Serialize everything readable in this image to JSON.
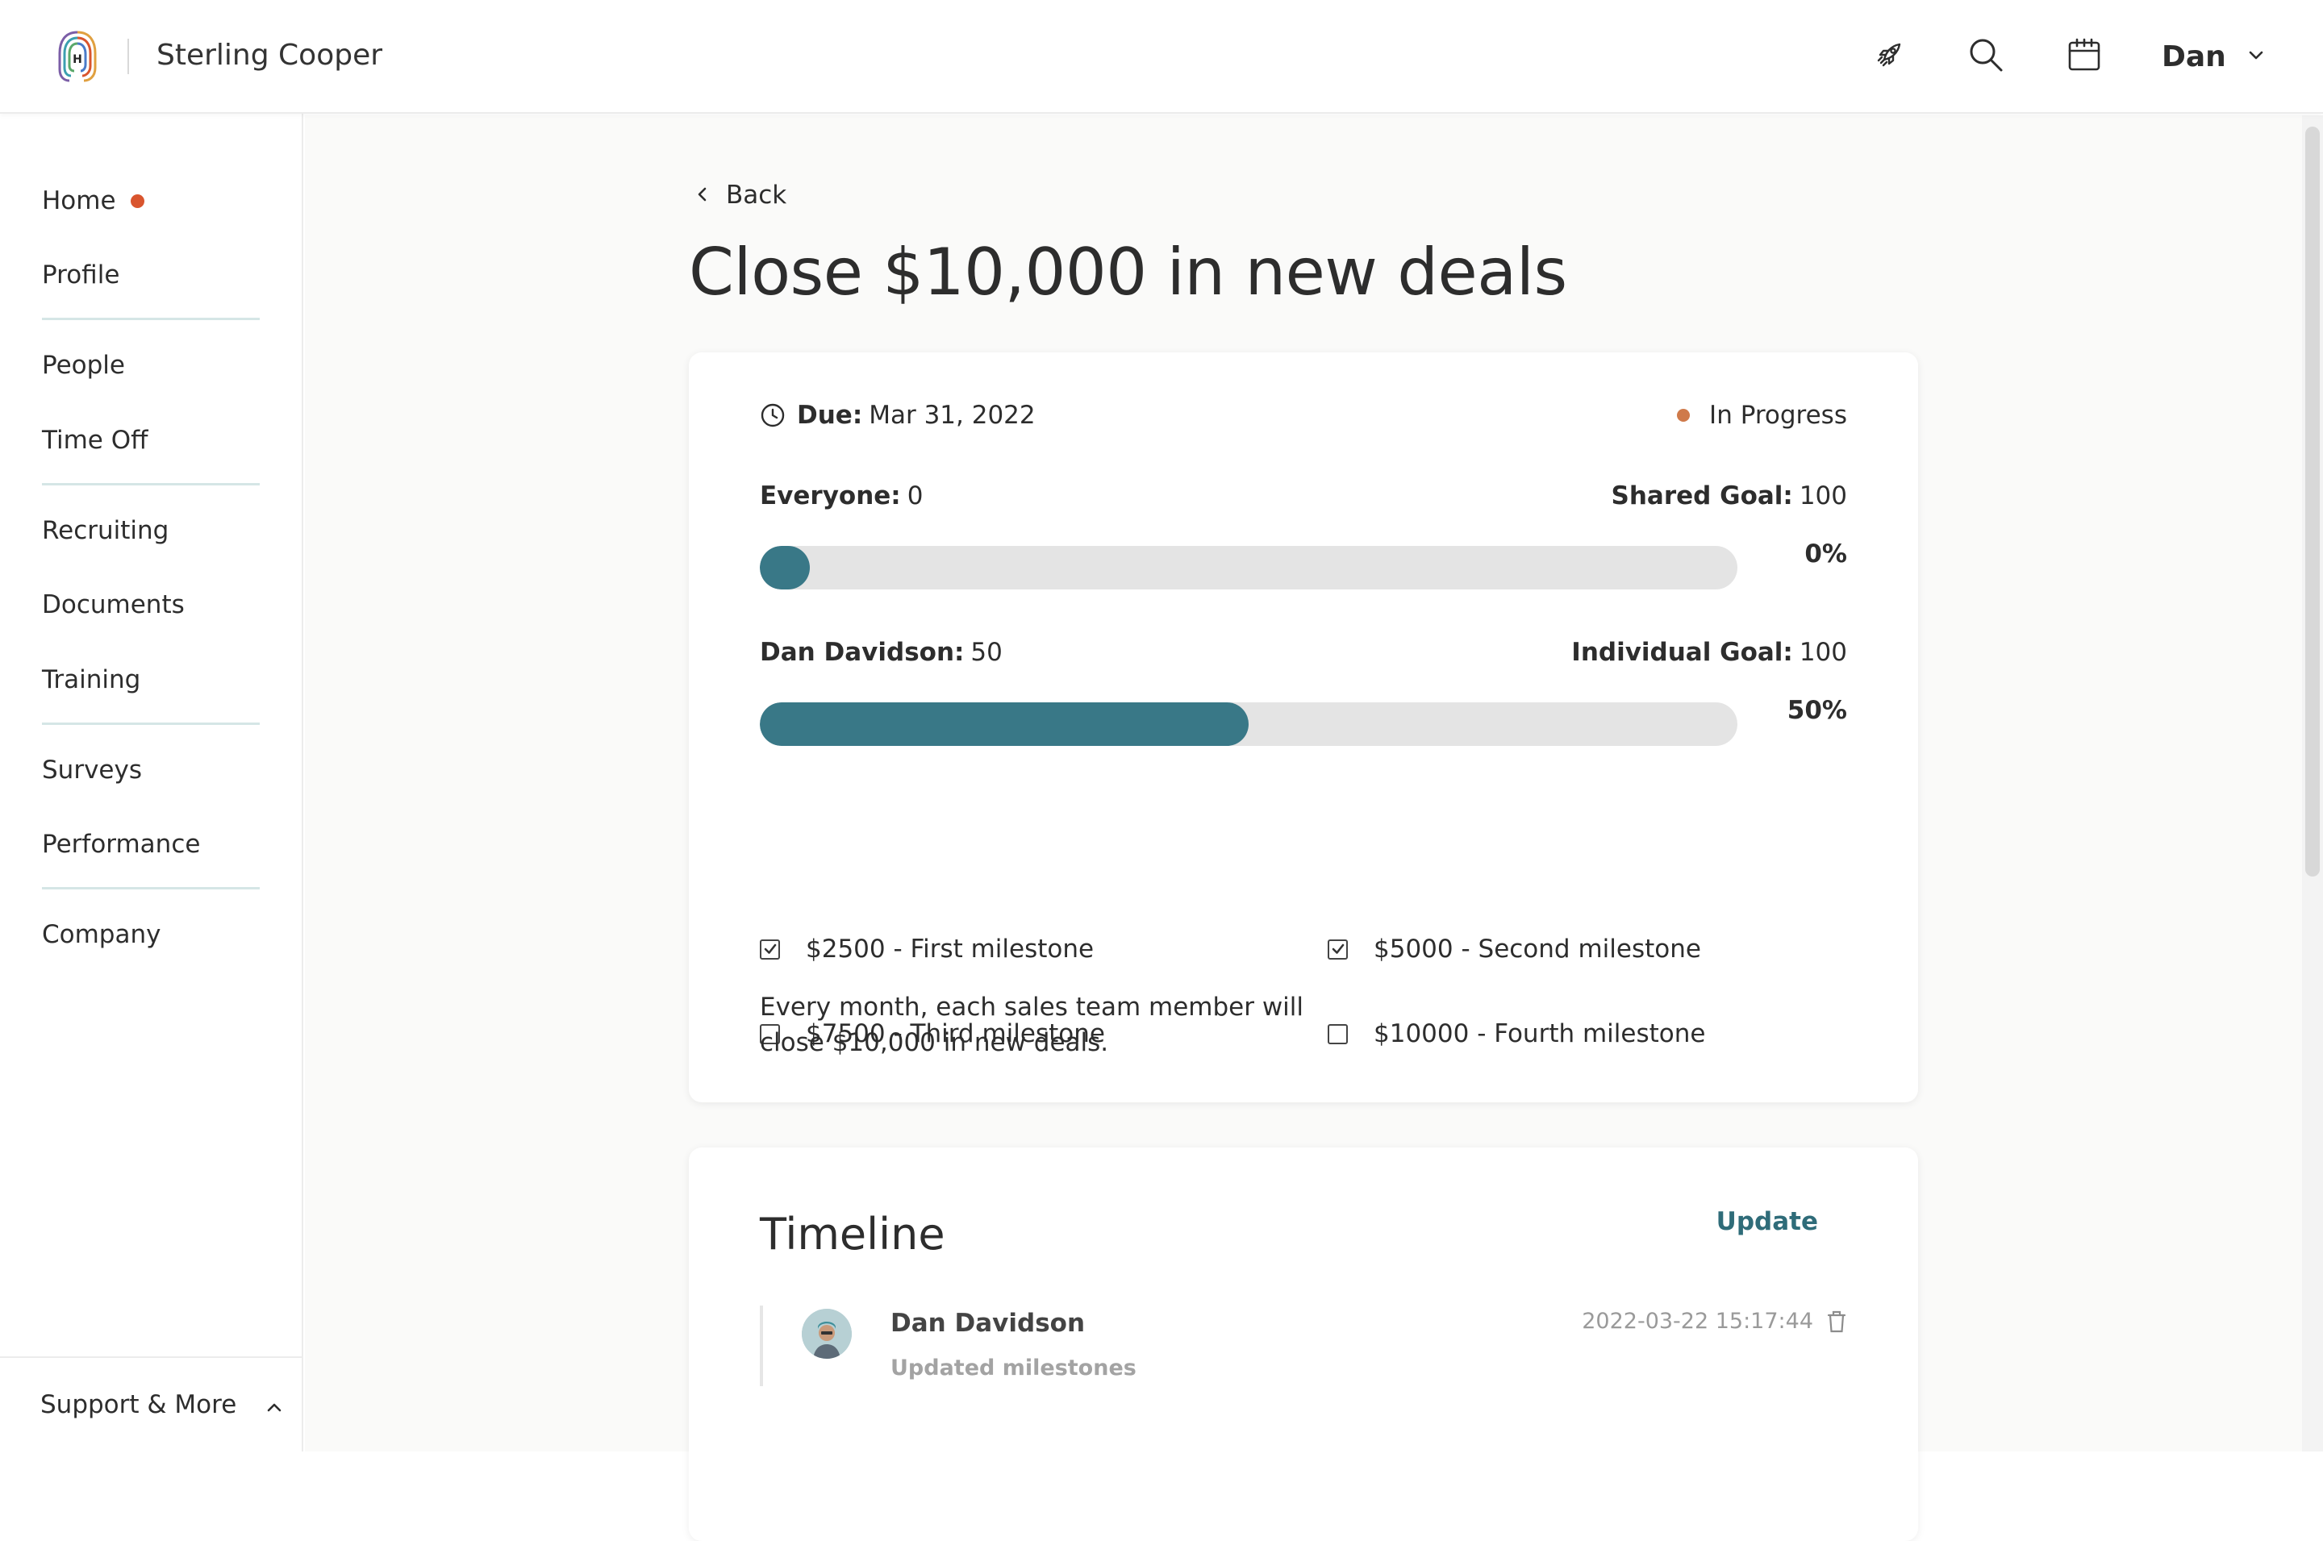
{
  "header": {
    "company": "Sterling Cooper",
    "user": "Dan",
    "icons": [
      "rocket-icon",
      "search-icon",
      "calendar-icon",
      "chevron-down-icon"
    ]
  },
  "sidebar": {
    "items": [
      {
        "label": "Home",
        "has_dot": true
      },
      {
        "label": "Profile"
      },
      {
        "label": "People"
      },
      {
        "label": "Time Off"
      },
      {
        "label": "Recruiting"
      },
      {
        "label": "Documents"
      },
      {
        "label": "Training"
      },
      {
        "label": "Surveys"
      },
      {
        "label": "Performance"
      },
      {
        "label": "Company"
      }
    ],
    "support": "Support & More"
  },
  "page": {
    "back": "Back",
    "title": "Close $10,000 in new deals"
  },
  "goal": {
    "due_label": "Due:",
    "due_value": "Mar 31, 2022",
    "status": "In Progress",
    "status_color": "#cf7a4a",
    "shared": {
      "left_label": "Everyone:",
      "left_value": "0",
      "right_label": "Shared Goal:",
      "right_value": "100",
      "percent": "0%",
      "progress": 0
    },
    "individual": {
      "left_label": "Dan Davidson:",
      "left_value": "50",
      "right_label": "Individual Goal:",
      "right_value": "100",
      "percent": "50%",
      "progress": 0.5
    },
    "milestones": [
      {
        "label": "$2500 - First milestone",
        "checked": true
      },
      {
        "label": "$5000 - Second milestone",
        "checked": true
      },
      {
        "label": "$7500 - Third milestone",
        "checked": false
      },
      {
        "label": "$10000 - Fourth milestone",
        "checked": false
      }
    ],
    "description": "Every month, each sales team member will close $10,000 in new deals.",
    "accent": "#397887"
  },
  "timeline": {
    "title": "Timeline",
    "update": "Update",
    "entries": [
      {
        "name": "Dan Davidson",
        "action": "Updated milestones",
        "timestamp": "2022-03-22 15:17:44"
      }
    ]
  }
}
